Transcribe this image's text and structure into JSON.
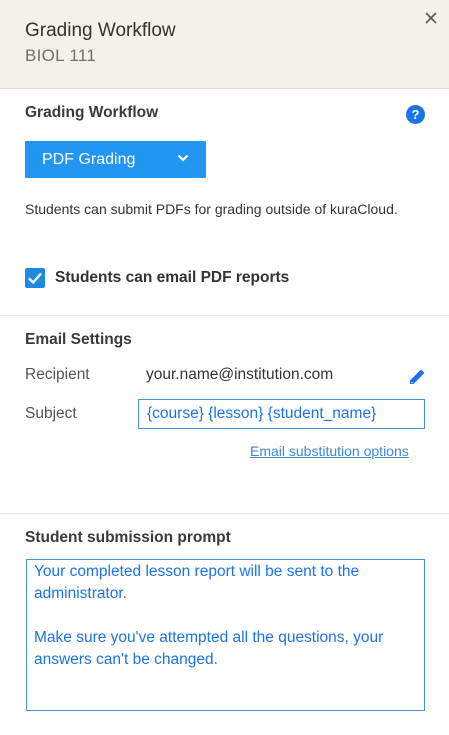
{
  "header": {
    "title": "Grading Workflow",
    "subtitle": "BIOL 111"
  },
  "workflow": {
    "section_title": "Grading Workflow",
    "help_symbol": "?",
    "dropdown_value": "PDF Grading",
    "description": "Students can submit PDFs for grading outside of kuraCloud.",
    "checkbox_label": "Students can email PDF reports",
    "checkbox_checked": true
  },
  "email_settings": {
    "section_title": "Email Settings",
    "recipient_label": "Recipient",
    "recipient_value": "your.name@institution.com",
    "subject_label": "Subject",
    "subject_value": "{course} {lesson} {student_name}",
    "substitution_link": "Email substitution options"
  },
  "submission_prompt": {
    "section_title": "Student submission prompt",
    "text": "Your completed lesson report will be sent to the administrator.\n\nMake sure you've attempted all the questions, your answers can't be changed."
  },
  "icons": {
    "close": "close-icon",
    "help": "help-icon",
    "dropdown": "chevron-down-icon",
    "checkbox": "checkmark-icon",
    "edit": "pencil-icon"
  },
  "colors": {
    "header_bg": "#f4f1ea",
    "accent_blue": "#2196f3",
    "link_blue": "#3f86d0",
    "input_text_blue": "#1a73e8"
  }
}
